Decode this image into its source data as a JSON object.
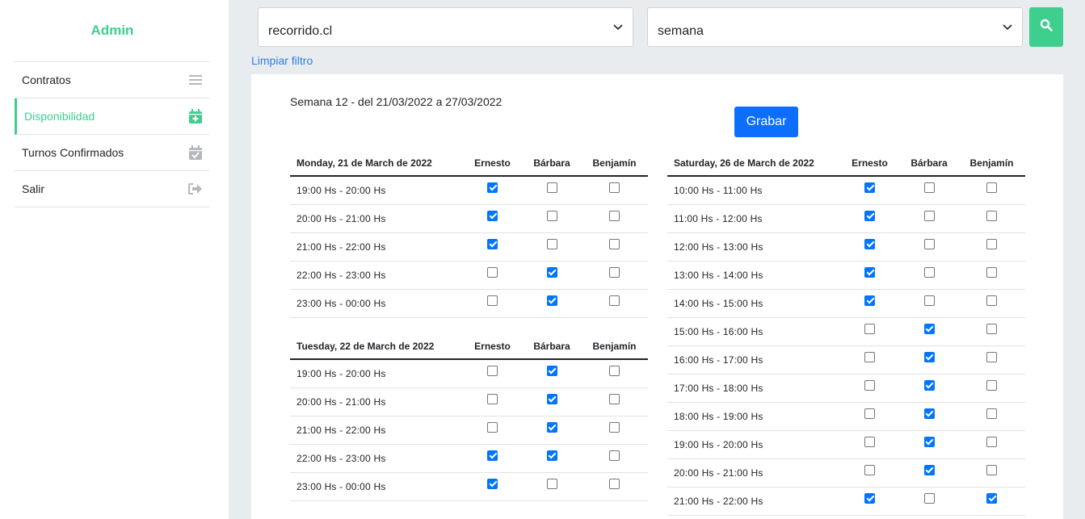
{
  "sidebar": {
    "brand": "Admin",
    "items": [
      {
        "label": "Contratos",
        "icon": "menu-lines-icon",
        "active": false
      },
      {
        "label": "Disponibilidad",
        "icon": "calendar-plus-icon",
        "active": true
      },
      {
        "label": "Turnos Confirmados",
        "icon": "calendar-check-icon",
        "active": false
      },
      {
        "label": "Salir",
        "icon": "sign-out-icon",
        "active": false
      }
    ]
  },
  "filters": {
    "site_select": "recorrido.cl",
    "period_select": "semana",
    "clear_link": "Limpiar filtro"
  },
  "main": {
    "week_title": "Semana 12 - del 21/03/2022 a 27/03/2022",
    "save_label": "Grabar",
    "people": [
      "Ernesto",
      "Bárbara",
      "Benjamín"
    ],
    "days": [
      {
        "label": "Monday, 21 de March de 2022",
        "slots": [
          {
            "time": "19:00 Hs - 20:00 Hs",
            "checks": [
              true,
              false,
              false
            ]
          },
          {
            "time": "20:00 Hs - 21:00 Hs",
            "checks": [
              true,
              false,
              false
            ]
          },
          {
            "time": "21:00 Hs - 22:00 Hs",
            "checks": [
              true,
              false,
              false
            ]
          },
          {
            "time": "22:00 Hs - 23:00 Hs",
            "checks": [
              false,
              true,
              false
            ]
          },
          {
            "time": "23:00 Hs - 00:00 Hs",
            "checks": [
              false,
              true,
              false
            ]
          }
        ]
      },
      {
        "label": "Tuesday, 22 de March de 2022",
        "slots": [
          {
            "time": "19:00 Hs - 20:00 Hs",
            "checks": [
              false,
              true,
              false
            ]
          },
          {
            "time": "20:00 Hs - 21:00 Hs",
            "checks": [
              false,
              true,
              false
            ]
          },
          {
            "time": "21:00 Hs - 22:00 Hs",
            "checks": [
              false,
              true,
              false
            ]
          },
          {
            "time": "22:00 Hs - 23:00 Hs",
            "checks": [
              true,
              true,
              false
            ]
          },
          {
            "time": "23:00 Hs - 00:00 Hs",
            "checks": [
              true,
              false,
              false
            ]
          }
        ]
      },
      {
        "label": "Saturday, 26 de March de 2022",
        "slots": [
          {
            "time": "10:00 Hs - 11:00 Hs",
            "checks": [
              true,
              false,
              false
            ]
          },
          {
            "time": "11:00 Hs - 12:00 Hs",
            "checks": [
              true,
              false,
              false
            ]
          },
          {
            "time": "12:00 Hs - 13:00 Hs",
            "checks": [
              true,
              false,
              false
            ]
          },
          {
            "time": "13:00 Hs - 14:00 Hs",
            "checks": [
              true,
              false,
              false
            ]
          },
          {
            "time": "14:00 Hs - 15:00 Hs",
            "checks": [
              true,
              false,
              false
            ]
          },
          {
            "time": "15:00 Hs - 16:00 Hs",
            "checks": [
              false,
              true,
              false
            ]
          },
          {
            "time": "16:00 Hs - 17:00 Hs",
            "checks": [
              false,
              true,
              false
            ]
          },
          {
            "time": "17:00 Hs - 18:00 Hs",
            "checks": [
              false,
              true,
              false
            ]
          },
          {
            "time": "18:00 Hs - 19:00 Hs",
            "checks": [
              false,
              true,
              false
            ]
          },
          {
            "time": "19:00 Hs - 20:00 Hs",
            "checks": [
              false,
              true,
              false
            ]
          },
          {
            "time": "20:00 Hs - 21:00 Hs",
            "checks": [
              false,
              true,
              false
            ]
          },
          {
            "time": "21:00 Hs - 22:00 Hs",
            "checks": [
              true,
              false,
              true
            ]
          }
        ]
      }
    ]
  },
  "colors": {
    "brand_green": "#3ecf8e",
    "primary_blue": "#0d6efd",
    "link_blue": "#2b7de9",
    "checkbox_blue": "#0075ff",
    "background": "#e9ecef"
  }
}
